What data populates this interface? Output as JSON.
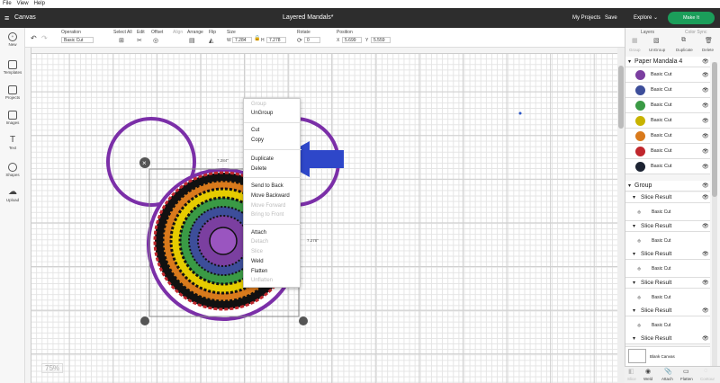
{
  "menubar": {
    "file": "File",
    "view": "View",
    "help": "Help"
  },
  "header": {
    "app_section": "Canvas",
    "doc_title": "Layered Mandals*",
    "my_projects": "My Projects",
    "save": "Save",
    "explore": "Explore",
    "make_it": "Make It"
  },
  "toolbar": {
    "operation_label": "Operation",
    "operation_value": "Basic Cut",
    "select_all": "Select All",
    "edit": "Edit",
    "offset": "Offset",
    "align": "Align",
    "arrange": "Arrange",
    "flip": "Flip",
    "size": "Size",
    "w_label": "W",
    "w_value": "7.284",
    "h_label": "H",
    "h_value": "7.278",
    "rotate": "Rotate",
    "rotate_value": "0",
    "position": "Position",
    "x_label": "X",
    "x_value": "5.699",
    "y_label": "Y",
    "y_value": "5.559"
  },
  "leftbar": [
    "New",
    "Templates",
    "Projects",
    "Images",
    "Text",
    "Shapes",
    "Upload"
  ],
  "canvas": {
    "width_label": "7.284\"",
    "height_label": "7.278\"",
    "zoom": "75%"
  },
  "context_menu": {
    "group": "Group",
    "ungroup": "UnGroup",
    "cut": "Cut",
    "copy": "Copy",
    "duplicate": "Duplicate",
    "delete": "Delete",
    "send_to_back": "Send to Back",
    "move_backward": "Move Backward",
    "move_forward": "Move Forward",
    "bring_to_front": "Bring to Front",
    "attach": "Attach",
    "detach": "Detach",
    "slice": "Slice",
    "weld": "Weld",
    "flatten": "Flatten",
    "unflatten": "Unflatten"
  },
  "panel": {
    "tabs": {
      "layers": "Layers",
      "color_sync": "Color Sync"
    },
    "actions": {
      "group": "Group",
      "ungroup": "UnGroup",
      "duplicate": "Duplicate",
      "delete": "Delete"
    },
    "group_title": "Paper Mandala 4",
    "layers": [
      {
        "label": "Basic Cut",
        "color": "#7b3fa0"
      },
      {
        "label": "Basic Cut",
        "color": "#3d4e9a"
      },
      {
        "label": "Basic Cut",
        "color": "#3a9a45"
      },
      {
        "label": "Basic Cut",
        "color": "#c8b300"
      },
      {
        "label": "Basic Cut",
        "color": "#d97a1c"
      },
      {
        "label": "Basic Cut",
        "color": "#c0272d"
      },
      {
        "label": "Basic Cut",
        "color": "#1d2433"
      }
    ],
    "group2_title": "Group",
    "slices": [
      {
        "title": "Slice Result",
        "label": "Basic Cut"
      },
      {
        "title": "Slice Result",
        "label": "Basic Cut"
      },
      {
        "title": "Slice Result",
        "label": "Basic Cut"
      },
      {
        "title": "Slice Result",
        "label": "Basic Cut"
      },
      {
        "title": "Slice Result",
        "label": "Basic Cut"
      },
      {
        "title": "Slice Result",
        "label": ""
      }
    ],
    "blank_canvas": "Blank Canvas",
    "bottom": {
      "slice": "Slice",
      "weld": "Weld",
      "attach": "Attach",
      "flatten": "Flatten",
      "contour": "Contour"
    }
  }
}
